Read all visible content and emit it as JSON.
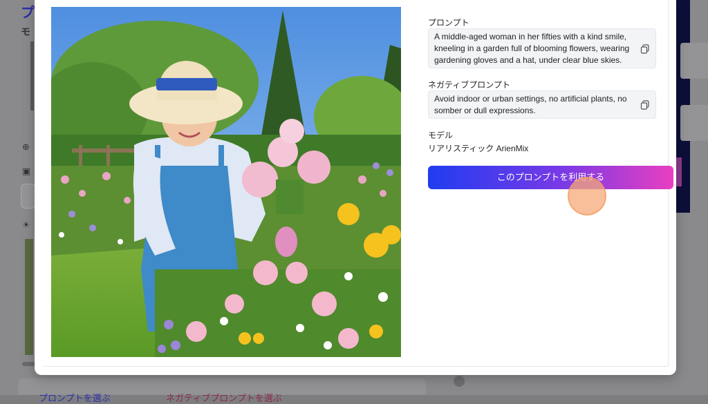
{
  "background": {
    "title": "プ",
    "subtitle": "モ",
    "bottom_left_label": "プロンプトを選ぶ",
    "bottom_right_label": "ネガティブプロンプトを選ぶ"
  },
  "modal": {
    "prompt": {
      "label": "プロンプト",
      "text": "A middle-aged woman in her fifties with a kind smile, kneeling in a garden full of blooming flowers, wearing gardening gloves and a hat, under clear blue skies.",
      "copy_icon": "copy-icon"
    },
    "negative_prompt": {
      "label": "ネガティブプロンプト",
      "text": "Avoid indoor or urban settings, no artificial plants, no somber or dull expressions.",
      "copy_icon": "copy-icon"
    },
    "model": {
      "label": "モデル",
      "value": "リアリスティック ArienMix"
    },
    "use_button_label": "このプロンプトを利用する"
  },
  "colors": {
    "button_gradient_start": "#1f3cf0",
    "button_gradient_end": "#e83fc0",
    "accent_blue": "#2a2fa8"
  }
}
